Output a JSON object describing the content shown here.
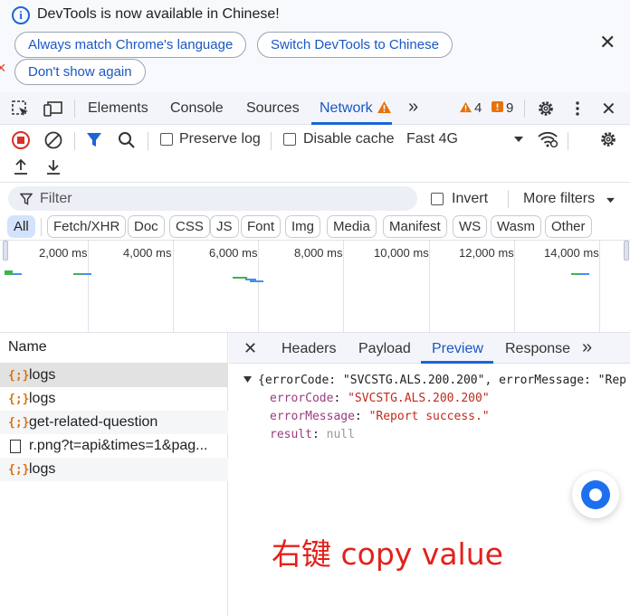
{
  "infobar": {
    "message": "DevTools is now available in Chinese!",
    "buttons": [
      "Always match Chrome's language",
      "Switch DevTools to Chinese",
      "Don't show again"
    ],
    "close": "✕"
  },
  "toolbar": {
    "tabs": [
      "Elements",
      "Console",
      "Sources",
      "Network"
    ],
    "active_tab": "Network",
    "more_tabs": "»",
    "warnings": "4",
    "errors": "9"
  },
  "network_toolbar": {
    "preserve_log": "Preserve log",
    "disable_cache": "Disable cache",
    "throttling": "Fast 4G"
  },
  "filter": {
    "placeholder": "Filter",
    "invert": "Invert",
    "more_filters": "More filters"
  },
  "type_chips": [
    "All",
    "Fetch/XHR",
    "Doc",
    "CSS",
    "JS",
    "Font",
    "Img",
    "Media",
    "Manifest",
    "WS",
    "Wasm",
    "Other"
  ],
  "timeline": {
    "ticks": [
      "2,000 ms",
      "4,000 ms",
      "6,000 ms",
      "8,000 ms",
      "10,000 ms",
      "12,000 ms",
      "14,000 ms"
    ]
  },
  "requests": {
    "header": "Name",
    "rows": [
      {
        "name": "logs",
        "type": "xhr"
      },
      {
        "name": "logs",
        "type": "xhr"
      },
      {
        "name": "get-related-question",
        "type": "xhr"
      },
      {
        "name": "r.png?t=api&times=1&pag...",
        "type": "doc"
      },
      {
        "name": "logs",
        "type": "xhr"
      }
    ]
  },
  "detail": {
    "close": "✕",
    "tabs": [
      "Headers",
      "Payload",
      "Preview",
      "Response"
    ],
    "active_tab": "Preview",
    "more": "»",
    "preview": {
      "summary": "{errorCode: \"SVCSTG.ALS.200.200\", errorMessage: \"Rep",
      "lines": [
        {
          "key": "errorCode",
          "value": "\"SVCSTG.ALS.200.200\"",
          "kind": "string"
        },
        {
          "key": "errorMessage",
          "value": "\"Report success.\"",
          "kind": "string"
        },
        {
          "key": "result",
          "value": "null",
          "kind": "null"
        }
      ]
    }
  },
  "annotation": "右键 copy value",
  "colors": {
    "accent": "#1a66d6",
    "annotation": "#e3211a",
    "record": "#d93025"
  }
}
